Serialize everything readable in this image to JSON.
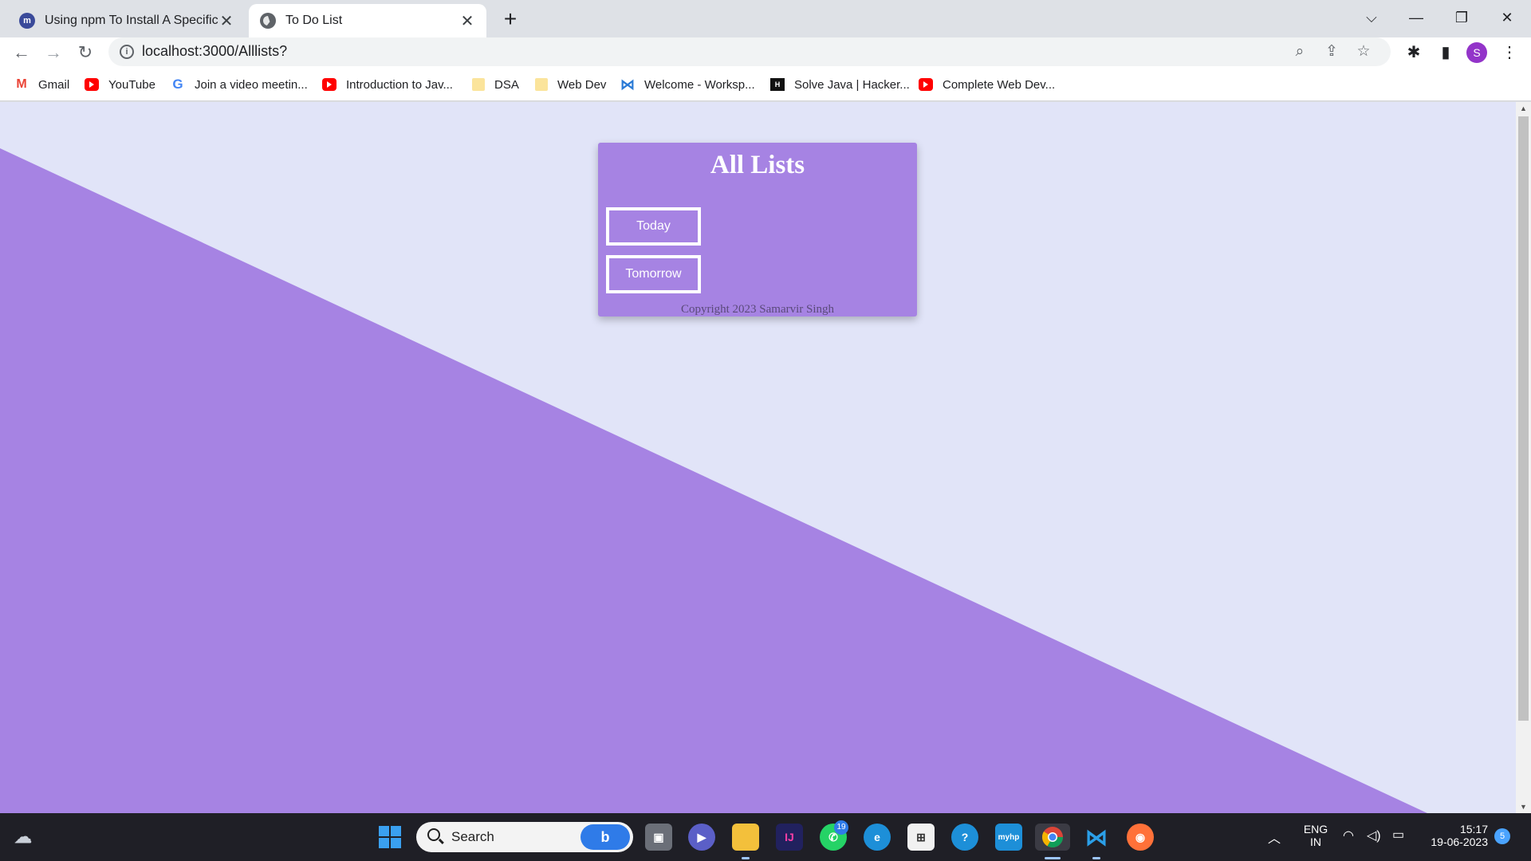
{
  "browser": {
    "tabs": [
      {
        "title": "Using npm To Install A Specific V",
        "active": false,
        "icon": "npm-favicon-icon"
      },
      {
        "title": "To Do List",
        "active": true,
        "icon": "globe-icon"
      }
    ],
    "new_tab_label": "+",
    "url": "localhost:3000/Alllists?",
    "bookmarks": [
      {
        "label": "Gmail",
        "icon": "gmail-icon"
      },
      {
        "label": "YouTube",
        "icon": "youtube-icon"
      },
      {
        "label": "Join a video meetin...",
        "icon": "google-icon"
      },
      {
        "label": "Introduction to Jav...",
        "icon": "youtube-icon"
      },
      {
        "label": "DSA",
        "icon": "folder-icon"
      },
      {
        "label": "Web Dev",
        "icon": "folder-icon"
      },
      {
        "label": "Welcome - Worksp...",
        "icon": "vscode-icon"
      },
      {
        "label": "Solve Java | Hacker...",
        "icon": "hackerrank-icon"
      },
      {
        "label": "Complete Web Dev...",
        "icon": "youtube-icon"
      }
    ],
    "profile_initial": "S"
  },
  "page": {
    "title": "All Lists",
    "lists": [
      "Today",
      "Tomorrow"
    ],
    "copyright": "Copyright 2023 Samarvir Singh"
  },
  "taskbar": {
    "search_label": "Search",
    "whatsapp_badge": "19",
    "language": "ENG",
    "region": "IN",
    "time": "15:17",
    "date": "19-06-2023",
    "notification_count": "5"
  },
  "colors": {
    "accent_purple": "#a683e3",
    "page_background": "#e1e4f8",
    "taskbar": "#1f1f26"
  }
}
